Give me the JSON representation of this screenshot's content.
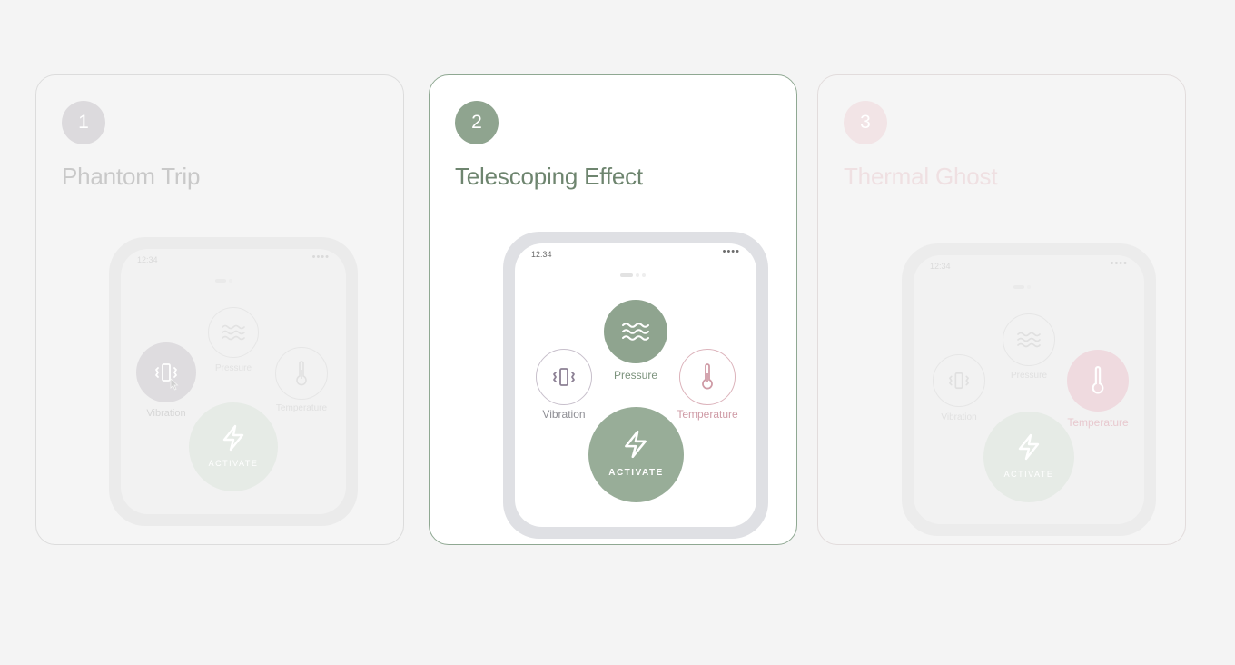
{
  "cards": [
    {
      "number": "1",
      "title": "Phantom Trip",
      "status_time": "12:34",
      "status_dots": "••••",
      "vibration_label": "Vibration",
      "pressure_label": "Pressure",
      "temperature_label": "Temperature",
      "activate_label": "ACTIVATE",
      "highlighted_control": "vibration"
    },
    {
      "number": "2",
      "title": "Telescoping Effect",
      "status_time": "12:34",
      "status_dots": "••••",
      "vibration_label": "Vibration",
      "pressure_label": "Pressure",
      "temperature_label": "Temperature",
      "activate_label": "ACTIVATE",
      "highlighted_control": "pressure"
    },
    {
      "number": "3",
      "title": "Thermal Ghost",
      "status_time": "12:34",
      "status_dots": "••••",
      "vibration_label": "Vibration",
      "pressure_label": "Pressure",
      "temperature_label": "Temperature",
      "activate_label": "ACTIVATE",
      "highlighted_control": "temperature"
    }
  ],
  "colors": {
    "sage": "#8fa48f",
    "sage_title": "#6e856f",
    "rose": "#d7a7b0",
    "grey_ring": "#c4bcc8",
    "active_card_border": "#8fa892"
  },
  "icons": {
    "vibration": "vibration-icon",
    "pressure": "waves-icon",
    "temperature": "thermometer-icon",
    "activate": "lightning-icon"
  }
}
